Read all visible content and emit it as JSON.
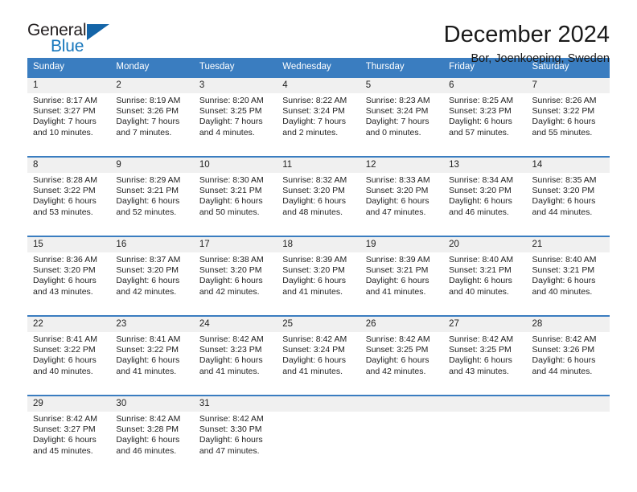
{
  "logo": {
    "word_top": "General",
    "word_bottom": "Blue",
    "triangle_icon": "triangle-icon",
    "brand_blue": "#1576bc",
    "brand_dark": "#231f20"
  },
  "header": {
    "title": "December 2024",
    "subtitle": "Bor, Joenkoeping, Sweden"
  },
  "calendar": {
    "header_bg": "#3a7dc0",
    "daynum_bg": "#f0f0f0",
    "weekdays": [
      "Sunday",
      "Monday",
      "Tuesday",
      "Wednesday",
      "Thursday",
      "Friday",
      "Saturday"
    ],
    "weeks": [
      [
        {
          "day": "1",
          "sunrise": "Sunrise: 8:17 AM",
          "sunset": "Sunset: 3:27 PM",
          "daylight_line1": "Daylight: 7 hours",
          "daylight_line2": "and 10 minutes."
        },
        {
          "day": "2",
          "sunrise": "Sunrise: 8:19 AM",
          "sunset": "Sunset: 3:26 PM",
          "daylight_line1": "Daylight: 7 hours",
          "daylight_line2": "and 7 minutes."
        },
        {
          "day": "3",
          "sunrise": "Sunrise: 8:20 AM",
          "sunset": "Sunset: 3:25 PM",
          "daylight_line1": "Daylight: 7 hours",
          "daylight_line2": "and 4 minutes."
        },
        {
          "day": "4",
          "sunrise": "Sunrise: 8:22 AM",
          "sunset": "Sunset: 3:24 PM",
          "daylight_line1": "Daylight: 7 hours",
          "daylight_line2": "and 2 minutes."
        },
        {
          "day": "5",
          "sunrise": "Sunrise: 8:23 AM",
          "sunset": "Sunset: 3:24 PM",
          "daylight_line1": "Daylight: 7 hours",
          "daylight_line2": "and 0 minutes."
        },
        {
          "day": "6",
          "sunrise": "Sunrise: 8:25 AM",
          "sunset": "Sunset: 3:23 PM",
          "daylight_line1": "Daylight: 6 hours",
          "daylight_line2": "and 57 minutes."
        },
        {
          "day": "7",
          "sunrise": "Sunrise: 8:26 AM",
          "sunset": "Sunset: 3:22 PM",
          "daylight_line1": "Daylight: 6 hours",
          "daylight_line2": "and 55 minutes."
        }
      ],
      [
        {
          "day": "8",
          "sunrise": "Sunrise: 8:28 AM",
          "sunset": "Sunset: 3:22 PM",
          "daylight_line1": "Daylight: 6 hours",
          "daylight_line2": "and 53 minutes."
        },
        {
          "day": "9",
          "sunrise": "Sunrise: 8:29 AM",
          "sunset": "Sunset: 3:21 PM",
          "daylight_line1": "Daylight: 6 hours",
          "daylight_line2": "and 52 minutes."
        },
        {
          "day": "10",
          "sunrise": "Sunrise: 8:30 AM",
          "sunset": "Sunset: 3:21 PM",
          "daylight_line1": "Daylight: 6 hours",
          "daylight_line2": "and 50 minutes."
        },
        {
          "day": "11",
          "sunrise": "Sunrise: 8:32 AM",
          "sunset": "Sunset: 3:20 PM",
          "daylight_line1": "Daylight: 6 hours",
          "daylight_line2": "and 48 minutes."
        },
        {
          "day": "12",
          "sunrise": "Sunrise: 8:33 AM",
          "sunset": "Sunset: 3:20 PM",
          "daylight_line1": "Daylight: 6 hours",
          "daylight_line2": "and 47 minutes."
        },
        {
          "day": "13",
          "sunrise": "Sunrise: 8:34 AM",
          "sunset": "Sunset: 3:20 PM",
          "daylight_line1": "Daylight: 6 hours",
          "daylight_line2": "and 46 minutes."
        },
        {
          "day": "14",
          "sunrise": "Sunrise: 8:35 AM",
          "sunset": "Sunset: 3:20 PM",
          "daylight_line1": "Daylight: 6 hours",
          "daylight_line2": "and 44 minutes."
        }
      ],
      [
        {
          "day": "15",
          "sunrise": "Sunrise: 8:36 AM",
          "sunset": "Sunset: 3:20 PM",
          "daylight_line1": "Daylight: 6 hours",
          "daylight_line2": "and 43 minutes."
        },
        {
          "day": "16",
          "sunrise": "Sunrise: 8:37 AM",
          "sunset": "Sunset: 3:20 PM",
          "daylight_line1": "Daylight: 6 hours",
          "daylight_line2": "and 42 minutes."
        },
        {
          "day": "17",
          "sunrise": "Sunrise: 8:38 AM",
          "sunset": "Sunset: 3:20 PM",
          "daylight_line1": "Daylight: 6 hours",
          "daylight_line2": "and 42 minutes."
        },
        {
          "day": "18",
          "sunrise": "Sunrise: 8:39 AM",
          "sunset": "Sunset: 3:20 PM",
          "daylight_line1": "Daylight: 6 hours",
          "daylight_line2": "and 41 minutes."
        },
        {
          "day": "19",
          "sunrise": "Sunrise: 8:39 AM",
          "sunset": "Sunset: 3:21 PM",
          "daylight_line1": "Daylight: 6 hours",
          "daylight_line2": "and 41 minutes."
        },
        {
          "day": "20",
          "sunrise": "Sunrise: 8:40 AM",
          "sunset": "Sunset: 3:21 PM",
          "daylight_line1": "Daylight: 6 hours",
          "daylight_line2": "and 40 minutes."
        },
        {
          "day": "21",
          "sunrise": "Sunrise: 8:40 AM",
          "sunset": "Sunset: 3:21 PM",
          "daylight_line1": "Daylight: 6 hours",
          "daylight_line2": "and 40 minutes."
        }
      ],
      [
        {
          "day": "22",
          "sunrise": "Sunrise: 8:41 AM",
          "sunset": "Sunset: 3:22 PM",
          "daylight_line1": "Daylight: 6 hours",
          "daylight_line2": "and 40 minutes."
        },
        {
          "day": "23",
          "sunrise": "Sunrise: 8:41 AM",
          "sunset": "Sunset: 3:22 PM",
          "daylight_line1": "Daylight: 6 hours",
          "daylight_line2": "and 41 minutes."
        },
        {
          "day": "24",
          "sunrise": "Sunrise: 8:42 AM",
          "sunset": "Sunset: 3:23 PM",
          "daylight_line1": "Daylight: 6 hours",
          "daylight_line2": "and 41 minutes."
        },
        {
          "day": "25",
          "sunrise": "Sunrise: 8:42 AM",
          "sunset": "Sunset: 3:24 PM",
          "daylight_line1": "Daylight: 6 hours",
          "daylight_line2": "and 41 minutes."
        },
        {
          "day": "26",
          "sunrise": "Sunrise: 8:42 AM",
          "sunset": "Sunset: 3:25 PM",
          "daylight_line1": "Daylight: 6 hours",
          "daylight_line2": "and 42 minutes."
        },
        {
          "day": "27",
          "sunrise": "Sunrise: 8:42 AM",
          "sunset": "Sunset: 3:25 PM",
          "daylight_line1": "Daylight: 6 hours",
          "daylight_line2": "and 43 minutes."
        },
        {
          "day": "28",
          "sunrise": "Sunrise: 8:42 AM",
          "sunset": "Sunset: 3:26 PM",
          "daylight_line1": "Daylight: 6 hours",
          "daylight_line2": "and 44 minutes."
        }
      ],
      [
        {
          "day": "29",
          "sunrise": "Sunrise: 8:42 AM",
          "sunset": "Sunset: 3:27 PM",
          "daylight_line1": "Daylight: 6 hours",
          "daylight_line2": "and 45 minutes."
        },
        {
          "day": "30",
          "sunrise": "Sunrise: 8:42 AM",
          "sunset": "Sunset: 3:28 PM",
          "daylight_line1": "Daylight: 6 hours",
          "daylight_line2": "and 46 minutes."
        },
        {
          "day": "31",
          "sunrise": "Sunrise: 8:42 AM",
          "sunset": "Sunset: 3:30 PM",
          "daylight_line1": "Daylight: 6 hours",
          "daylight_line2": "and 47 minutes."
        },
        {
          "day": "",
          "sunrise": "",
          "sunset": "",
          "daylight_line1": "",
          "daylight_line2": ""
        },
        {
          "day": "",
          "sunrise": "",
          "sunset": "",
          "daylight_line1": "",
          "daylight_line2": ""
        },
        {
          "day": "",
          "sunrise": "",
          "sunset": "",
          "daylight_line1": "",
          "daylight_line2": ""
        },
        {
          "day": "",
          "sunrise": "",
          "sunset": "",
          "daylight_line1": "",
          "daylight_line2": ""
        }
      ]
    ]
  }
}
